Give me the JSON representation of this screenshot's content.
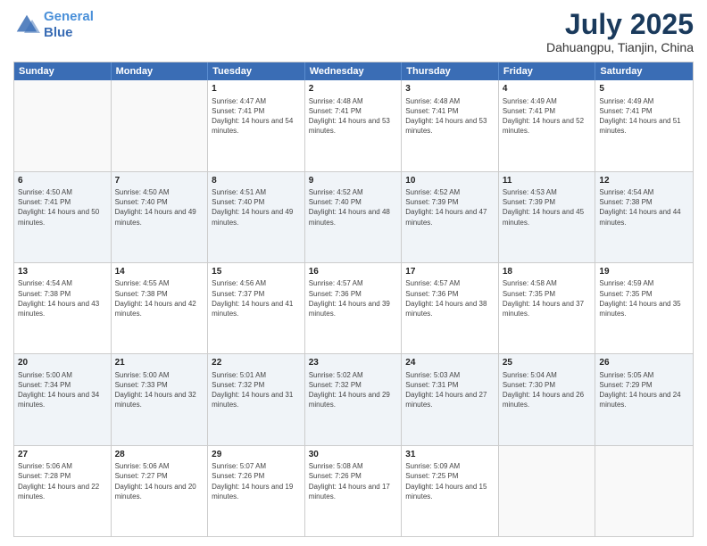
{
  "logo": {
    "line1": "General",
    "line2": "Blue"
  },
  "title": "July 2025",
  "location": "Dahuangpu, Tianjin, China",
  "days_of_week": [
    "Sunday",
    "Monday",
    "Tuesday",
    "Wednesday",
    "Thursday",
    "Friday",
    "Saturday"
  ],
  "weeks": [
    [
      {
        "day": "",
        "info": ""
      },
      {
        "day": "",
        "info": ""
      },
      {
        "day": "1",
        "info": "Sunrise: 4:47 AM\nSunset: 7:41 PM\nDaylight: 14 hours and 54 minutes."
      },
      {
        "day": "2",
        "info": "Sunrise: 4:48 AM\nSunset: 7:41 PM\nDaylight: 14 hours and 53 minutes."
      },
      {
        "day": "3",
        "info": "Sunrise: 4:48 AM\nSunset: 7:41 PM\nDaylight: 14 hours and 53 minutes."
      },
      {
        "day": "4",
        "info": "Sunrise: 4:49 AM\nSunset: 7:41 PM\nDaylight: 14 hours and 52 minutes."
      },
      {
        "day": "5",
        "info": "Sunrise: 4:49 AM\nSunset: 7:41 PM\nDaylight: 14 hours and 51 minutes."
      }
    ],
    [
      {
        "day": "6",
        "info": "Sunrise: 4:50 AM\nSunset: 7:41 PM\nDaylight: 14 hours and 50 minutes."
      },
      {
        "day": "7",
        "info": "Sunrise: 4:50 AM\nSunset: 7:40 PM\nDaylight: 14 hours and 49 minutes."
      },
      {
        "day": "8",
        "info": "Sunrise: 4:51 AM\nSunset: 7:40 PM\nDaylight: 14 hours and 49 minutes."
      },
      {
        "day": "9",
        "info": "Sunrise: 4:52 AM\nSunset: 7:40 PM\nDaylight: 14 hours and 48 minutes."
      },
      {
        "day": "10",
        "info": "Sunrise: 4:52 AM\nSunset: 7:39 PM\nDaylight: 14 hours and 47 minutes."
      },
      {
        "day": "11",
        "info": "Sunrise: 4:53 AM\nSunset: 7:39 PM\nDaylight: 14 hours and 45 minutes."
      },
      {
        "day": "12",
        "info": "Sunrise: 4:54 AM\nSunset: 7:38 PM\nDaylight: 14 hours and 44 minutes."
      }
    ],
    [
      {
        "day": "13",
        "info": "Sunrise: 4:54 AM\nSunset: 7:38 PM\nDaylight: 14 hours and 43 minutes."
      },
      {
        "day": "14",
        "info": "Sunrise: 4:55 AM\nSunset: 7:38 PM\nDaylight: 14 hours and 42 minutes."
      },
      {
        "day": "15",
        "info": "Sunrise: 4:56 AM\nSunset: 7:37 PM\nDaylight: 14 hours and 41 minutes."
      },
      {
        "day": "16",
        "info": "Sunrise: 4:57 AM\nSunset: 7:36 PM\nDaylight: 14 hours and 39 minutes."
      },
      {
        "day": "17",
        "info": "Sunrise: 4:57 AM\nSunset: 7:36 PM\nDaylight: 14 hours and 38 minutes."
      },
      {
        "day": "18",
        "info": "Sunrise: 4:58 AM\nSunset: 7:35 PM\nDaylight: 14 hours and 37 minutes."
      },
      {
        "day": "19",
        "info": "Sunrise: 4:59 AM\nSunset: 7:35 PM\nDaylight: 14 hours and 35 minutes."
      }
    ],
    [
      {
        "day": "20",
        "info": "Sunrise: 5:00 AM\nSunset: 7:34 PM\nDaylight: 14 hours and 34 minutes."
      },
      {
        "day": "21",
        "info": "Sunrise: 5:00 AM\nSunset: 7:33 PM\nDaylight: 14 hours and 32 minutes."
      },
      {
        "day": "22",
        "info": "Sunrise: 5:01 AM\nSunset: 7:32 PM\nDaylight: 14 hours and 31 minutes."
      },
      {
        "day": "23",
        "info": "Sunrise: 5:02 AM\nSunset: 7:32 PM\nDaylight: 14 hours and 29 minutes."
      },
      {
        "day": "24",
        "info": "Sunrise: 5:03 AM\nSunset: 7:31 PM\nDaylight: 14 hours and 27 minutes."
      },
      {
        "day": "25",
        "info": "Sunrise: 5:04 AM\nSunset: 7:30 PM\nDaylight: 14 hours and 26 minutes."
      },
      {
        "day": "26",
        "info": "Sunrise: 5:05 AM\nSunset: 7:29 PM\nDaylight: 14 hours and 24 minutes."
      }
    ],
    [
      {
        "day": "27",
        "info": "Sunrise: 5:06 AM\nSunset: 7:28 PM\nDaylight: 14 hours and 22 minutes."
      },
      {
        "day": "28",
        "info": "Sunrise: 5:06 AM\nSunset: 7:27 PM\nDaylight: 14 hours and 20 minutes."
      },
      {
        "day": "29",
        "info": "Sunrise: 5:07 AM\nSunset: 7:26 PM\nDaylight: 14 hours and 19 minutes."
      },
      {
        "day": "30",
        "info": "Sunrise: 5:08 AM\nSunset: 7:26 PM\nDaylight: 14 hours and 17 minutes."
      },
      {
        "day": "31",
        "info": "Sunrise: 5:09 AM\nSunset: 7:25 PM\nDaylight: 14 hours and 15 minutes."
      },
      {
        "day": "",
        "info": ""
      },
      {
        "day": "",
        "info": ""
      }
    ]
  ]
}
